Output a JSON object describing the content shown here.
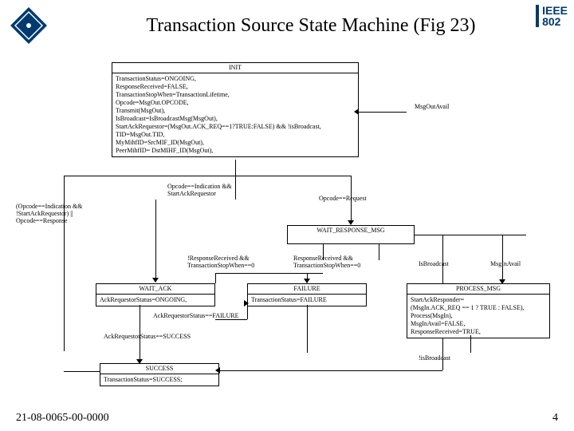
{
  "header": {
    "title": "Transaction Source State Machine (Fig 23)",
    "ieee_top": "IEEE",
    "ieee_bottom": "802"
  },
  "init": {
    "title": "INIT",
    "lines": [
      "TransactionStatus=ONGOING,",
      "ResponseReceived=FALSE,",
      "TransactionStopWhen=TransactionLifetime,",
      "Opcode=MsgOut.OPCODE,",
      "Transmit(MsgOut),",
      "IsBroadcast=IsBroadcastMsg(MsgOut),",
      "StartAckRequestor=(MsgOut.ACK_REQ==1?TRUE:FALSE) && !isBroadcast,",
      "TID=MsgOut.TID,",
      "MyMihfID=SrcMIF_ID(MsgOut),",
      "PeerMihfID= DstMIHF_ID(MsgOut),"
    ]
  },
  "labels": {
    "msg_out_avail": "MsgOutAvail",
    "opcode_ind_start": "Opcode==Indication &&\nStartAckRequestor",
    "left_cond": "(Opcode==Indication &&\n!StartAckRequestor) ||\nOpcode==Response",
    "opcode_request": "Opcode==Request",
    "not_resp": "!ResponseReceived &&\nTransactionStopWhen==0",
    "resp_rec": "ResponseReceived &&\nTransactionStopWhen==0",
    "is_broadcast": "IsBroadcast",
    "msg_in_avail": "MsgInAvail",
    "ack_stat_fail": "AckRequestorStatus==FAILURE",
    "ack_stat_succ": "AckRequestorStatus==SUCCESS",
    "not_broadcast": "!isBroadcast"
  },
  "wait_response": {
    "title": "WAIT_RESPONSE_MSG"
  },
  "wait_ack": {
    "title": "WAIT_ACK",
    "line1": "AckRequestorStatus=ONGOING,"
  },
  "failure": {
    "title": "FAILURE",
    "line1": "TransactionStatus=FAILURE"
  },
  "process": {
    "title": "PROCESS_MSG",
    "lines": [
      "StartAckResponder=",
      "  (MsgIn.ACK_REQ == 1 ? TRUE : FALSE),",
      "Process(MsgIn),",
      "MsgInAvail=FALSE,",
      "ResponseReceived=TRUE,"
    ]
  },
  "success": {
    "title": "SUCCESS",
    "line1": "TransactionStatus=SUCCESS;"
  },
  "footer": {
    "left": "21-08-0065-00-0000",
    "right": "4"
  }
}
